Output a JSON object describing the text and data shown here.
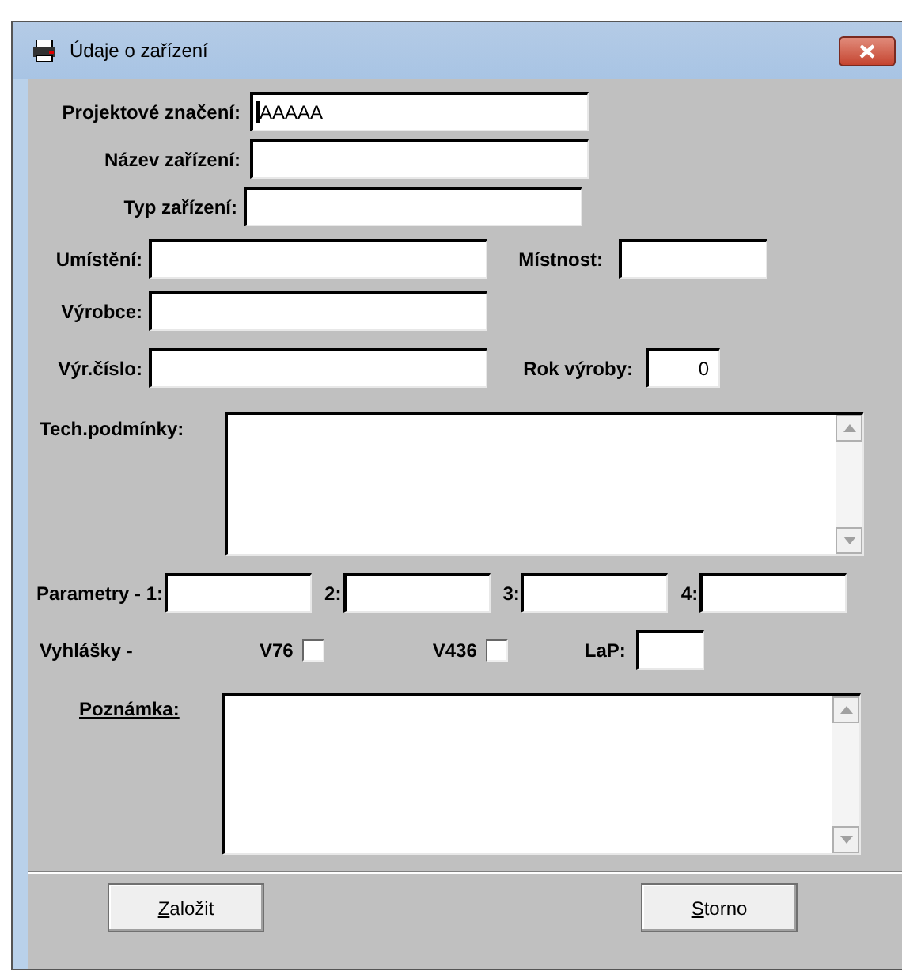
{
  "window": {
    "title": "Údaje o zařízení"
  },
  "top_fields": [
    {
      "label": "Projektové značení:",
      "value": "AAAAA"
    },
    {
      "label": "Název zařízení:"
    },
    {
      "label": "Typ zařízení:"
    }
  ],
  "umisteni": {
    "label": "Umístění:"
  },
  "mistnost": {
    "label": "Místnost:"
  },
  "vyrobce": {
    "label": "Výrobce:"
  },
  "vyr_cislo": {
    "label": "Výr.číslo:"
  },
  "rok_vyroby": {
    "label": "Rok výroby:",
    "value": "0"
  },
  "tech_podminky": {
    "label": "Tech.podmínky:"
  },
  "parametry": [
    {
      "label": "Parametry - 1:"
    },
    {
      "label": "2:"
    },
    {
      "label": "3:"
    },
    {
      "label": "4:"
    }
  ],
  "vyhlasky": {
    "label": "Vyhlášky -",
    "checkboxes": [
      {
        "label": "V76",
        "checked": false
      },
      {
        "label": "V436",
        "checked": false
      }
    ],
    "lap": {
      "label": "LaP:"
    }
  },
  "poznamka": {
    "label": "Poznámka:"
  },
  "buttons": [
    {
      "label": "Založit"
    },
    {
      "label": "Storno"
    }
  ]
}
